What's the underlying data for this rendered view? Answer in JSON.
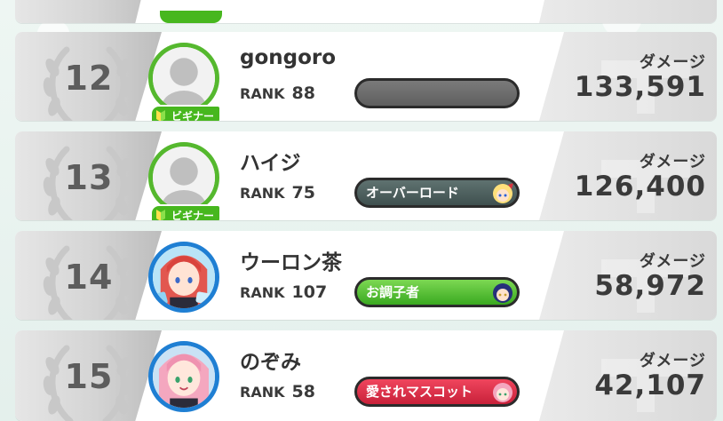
{
  "colors": {
    "beginner_green": "#47b71e",
    "avatar_ring_green": "#55b82e",
    "avatar_ring_blue": "#1f7fd3",
    "text_dark": "#3a3a3a",
    "badge_overlord": "#4f6160",
    "badge_tone": "#4cc02b",
    "badge_mascot": "#e0344c",
    "badge_blank": "#6b6b6b"
  },
  "icons": {
    "wreath": "laurel-wreath-icon",
    "beginner_leaf": "beginner-leaf-icon",
    "damage_bg": "damage-emblem-icon",
    "avatar_default": "default-avatar-silhouette"
  },
  "rankings": [
    {
      "place": "12",
      "name": "gongoro",
      "rank_label": "RANK",
      "rank": "88",
      "avatar": "default",
      "beginner": "ビギナー",
      "title": "",
      "title_style": "blank",
      "damage_label": "ダメージ",
      "damage": "133,591"
    },
    {
      "place": "13",
      "name": "ハイジ",
      "rank_label": "RANK",
      "rank": "75",
      "avatar": "default",
      "beginner": "ビギナー",
      "title": "オーバーロード",
      "title_style": "overlord",
      "damage_label": "ダメージ",
      "damage": "126,400"
    },
    {
      "place": "14",
      "name": "ウーロン茶",
      "rank_label": "RANK",
      "rank": "107",
      "avatar": "red-hair-girl",
      "beginner": "",
      "title": "お調子者",
      "title_style": "tone",
      "damage_label": "ダメージ",
      "damage": "58,972"
    },
    {
      "place": "15",
      "name": "のぞみ",
      "rank_label": "RANK",
      "rank": "58",
      "avatar": "pink-hair-girl",
      "beginner": "",
      "title": "愛されマスコット",
      "title_style": "mascot",
      "damage_label": "ダメージ",
      "damage": "42,107"
    }
  ]
}
